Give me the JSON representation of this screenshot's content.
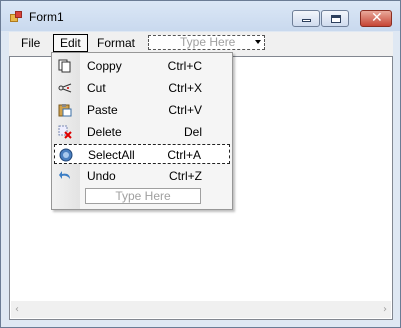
{
  "window": {
    "title": "Form1"
  },
  "menubar": {
    "items": [
      "File",
      "Edit",
      "Format"
    ],
    "type_here_placeholder": "Type Here"
  },
  "edit_menu": {
    "items": [
      {
        "label": "Coppy",
        "shortcut": "Ctrl+C",
        "icon": "copy-icon"
      },
      {
        "label": "Cut",
        "shortcut": "Ctrl+X",
        "icon": "scissors-icon"
      },
      {
        "label": "Paste",
        "shortcut": "Ctrl+V",
        "icon": "paste-icon"
      },
      {
        "label": "Delete",
        "shortcut": "Del",
        "icon": "delete-icon"
      },
      {
        "label": "SelectAll",
        "shortcut": "Ctrl+A",
        "icon": "select-all-icon"
      },
      {
        "label": "Undo",
        "shortcut": "Ctrl+Z",
        "icon": "undo-icon"
      }
    ],
    "type_here_placeholder": "Type Here"
  },
  "scrollbar": {
    "left_arrow": "‹",
    "right_arrow": "›"
  }
}
